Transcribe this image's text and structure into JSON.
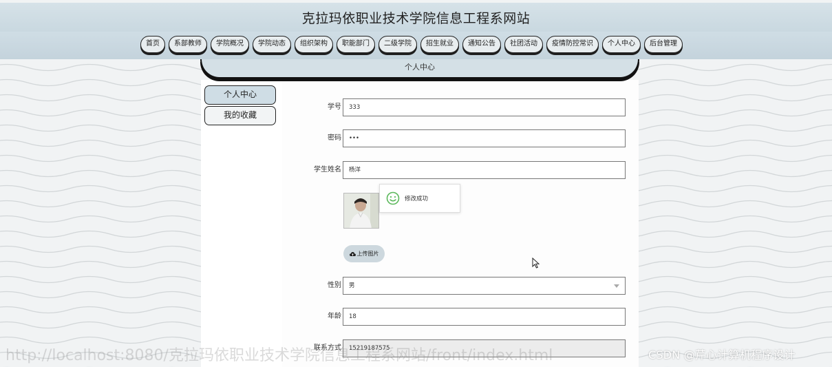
{
  "header": {
    "title": "克拉玛依职业技术学院信息工程系网站"
  },
  "nav": {
    "items": [
      {
        "label": "首页"
      },
      {
        "label": "系部教师"
      },
      {
        "label": "学院概况"
      },
      {
        "label": "学院动态"
      },
      {
        "label": "组织架构"
      },
      {
        "label": "职能部门"
      },
      {
        "label": "二级学院"
      },
      {
        "label": "招生就业"
      },
      {
        "label": "通知公告"
      },
      {
        "label": "社团活动"
      },
      {
        "label": "疫情防控常识"
      },
      {
        "label": "个人中心"
      },
      {
        "label": "后台管理"
      }
    ]
  },
  "breadcrumb": {
    "label": "个人中心"
  },
  "sidebar": {
    "items": [
      {
        "label": "个人中心",
        "active": true
      },
      {
        "label": "我的收藏",
        "active": false
      }
    ]
  },
  "form": {
    "student_id": {
      "label": "学号",
      "value": "333"
    },
    "password": {
      "label": "密码",
      "value": "•••"
    },
    "student_name": {
      "label": "学生姓名",
      "value": "杨洋"
    },
    "upload": {
      "label": "上传图片"
    },
    "gender": {
      "label": "性别",
      "value": "男"
    },
    "age": {
      "label": "年龄",
      "value": "18"
    },
    "contact": {
      "label": "联系方式",
      "value": "15219187575"
    }
  },
  "toast": {
    "message": "修改成功",
    "icon": "smile-icon",
    "color": "#5cb85c"
  },
  "watermark": {
    "text": "CSDN @芹心计算机程序设计"
  },
  "faded_watermark": {
    "text": "http://localhost:8080/克拉玛依职业技术学院信息工程系网站/front/index.html"
  },
  "colors": {
    "accent": "#cfdde5",
    "border": "#222222"
  }
}
